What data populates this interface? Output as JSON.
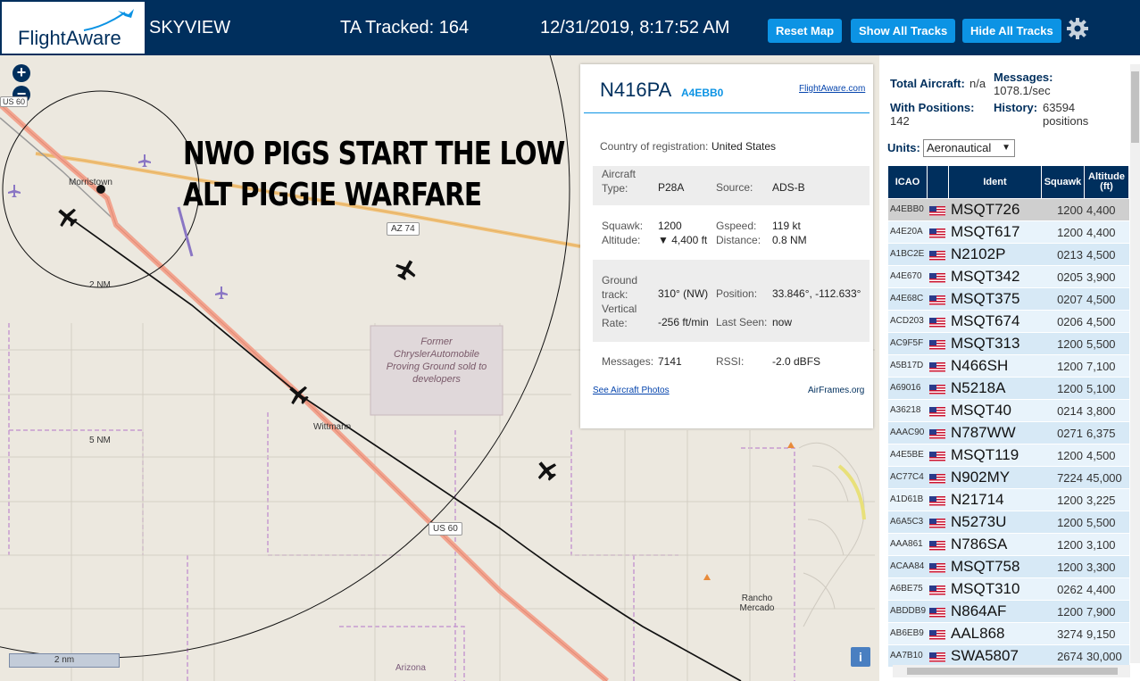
{
  "header": {
    "logo_text": "FlightAware",
    "app_name": "SKYVIEW",
    "tracked": "TA Tracked: 164",
    "datetime": "12/31/2019, 8:17:52 AM",
    "btn_reset": "Reset Map",
    "btn_show": "Show All Tracks",
    "btn_hide": "Hide All Tracks"
  },
  "map": {
    "overlay_line1": "NWO PIGS START THE LOW",
    "overlay_line2": "ALT PIGGIE WARFARE",
    "town1": "Morristown",
    "town2": "Wittmann",
    "area1": "Rancho Mercado",
    "area2": "Arizona",
    "landmark": "Former ChryslerAutomobile Proving Ground sold to developers",
    "road1": "AZ 74",
    "road2": "US 60",
    "road3": "US 60",
    "ring1": "2 NM",
    "ring2": "5 NM",
    "scale": "2 nm",
    "zoom_in": "+",
    "zoom_out": "−",
    "info": "i"
  },
  "popup": {
    "callsign": "N416PA",
    "hex": "A4EBB0",
    "fa_link": "FlightAware.com",
    "country_label": "Country of registration:",
    "country": "United States",
    "aircraft_type_label": "Aircraft Type:",
    "aircraft_type": "P28A",
    "source_label": "Source:",
    "source": "ADS-B",
    "squawk_label": "Squawk:",
    "squawk": "1200",
    "gspeed_label": "Gspeed:",
    "gspeed": "119 kt",
    "altitude_label": "Altitude:",
    "altitude": "▼ 4,400 ft",
    "distance_label": "Distance:",
    "distance": "0.8 NM",
    "track_label": "Ground track:",
    "track": "310° (NW)",
    "position_label": "Position:",
    "position": "33.846°, -112.633°",
    "vrate_label": "Vertical Rate:",
    "vrate": "-256 ft/min",
    "lastseen_label": "Last Seen:",
    "lastseen": "now",
    "messages_label": "Messages:",
    "messages": "7141",
    "rssi_label": "RSSI:",
    "rssi": "-2.0 dBFS",
    "photos_link": "See Aircraft Photos",
    "airframes_link": "AirFrames.org"
  },
  "panel": {
    "total_label": "Total Aircraft:",
    "total": "n/a",
    "messages_label": "Messages:",
    "messages": "1078.1/sec",
    "withpos_label": "With Positions:",
    "withpos": "142",
    "history_label": "History:",
    "history": "63594 positions",
    "units_label": "Units:",
    "units_value": "Aeronautical",
    "columns": [
      "ICAO",
      "",
      "Ident",
      "Squawk",
      "Altitude (ft)"
    ],
    "rows": [
      {
        "icao": "A4EBB0",
        "ident": "MSQT726",
        "squawk": "1200",
        "alt": "4,400"
      },
      {
        "icao": "A4E20A",
        "ident": "MSQT617",
        "squawk": "1200",
        "alt": "4,400"
      },
      {
        "icao": "A1BC2E",
        "ident": "N2102P",
        "squawk": "0213",
        "alt": "4,500"
      },
      {
        "icao": "A4E670",
        "ident": "MSQT342",
        "squawk": "0205",
        "alt": "3,900"
      },
      {
        "icao": "A4E68C",
        "ident": "MSQT375",
        "squawk": "0207",
        "alt": "4,500"
      },
      {
        "icao": "ACD203",
        "ident": "MSQT674",
        "squawk": "0206",
        "alt": "4,500"
      },
      {
        "icao": "AC9F5F",
        "ident": "MSQT313",
        "squawk": "1200",
        "alt": "5,500"
      },
      {
        "icao": "A5B17D",
        "ident": "N466SH",
        "squawk": "1200",
        "alt": "7,100"
      },
      {
        "icao": "A69016",
        "ident": "N5218A",
        "squawk": "1200",
        "alt": "5,100"
      },
      {
        "icao": "A36218",
        "ident": "MSQT40",
        "squawk": "0214",
        "alt": "3,800"
      },
      {
        "icao": "AAAC90",
        "ident": "N787WW",
        "squawk": "0271",
        "alt": "6,375"
      },
      {
        "icao": "A4E5BE",
        "ident": "MSQT119",
        "squawk": "1200",
        "alt": "4,500"
      },
      {
        "icao": "AC77C4",
        "ident": "N902MY",
        "squawk": "7224",
        "alt": "45,000"
      },
      {
        "icao": "A1D61B",
        "ident": "N21714",
        "squawk": "1200",
        "alt": "3,225"
      },
      {
        "icao": "A6A5C3",
        "ident": "N5273U",
        "squawk": "1200",
        "alt": "5,500"
      },
      {
        "icao": "AAA861",
        "ident": "N786SA",
        "squawk": "1200",
        "alt": "3,100"
      },
      {
        "icao": "ACAA84",
        "ident": "MSQT758",
        "squawk": "1200",
        "alt": "3,300"
      },
      {
        "icao": "A6BE75",
        "ident": "MSQT310",
        "squawk": "0262",
        "alt": "4,400"
      },
      {
        "icao": "ABDDB9",
        "ident": "N864AF",
        "squawk": "1200",
        "alt": "7,900"
      },
      {
        "icao": "AB6EB9",
        "ident": "AAL868",
        "squawk": "3274",
        "alt": "9,150"
      },
      {
        "icao": "AA7B10",
        "ident": "SWA5807",
        "squawk": "2674",
        "alt": "30,000"
      }
    ]
  },
  "colors": {
    "header_bg": "#002f5d",
    "button": "#0c93e4",
    "table_header": "#002f5d",
    "row_a": "#d7e9f6",
    "row_b": "#e8f3fb"
  }
}
